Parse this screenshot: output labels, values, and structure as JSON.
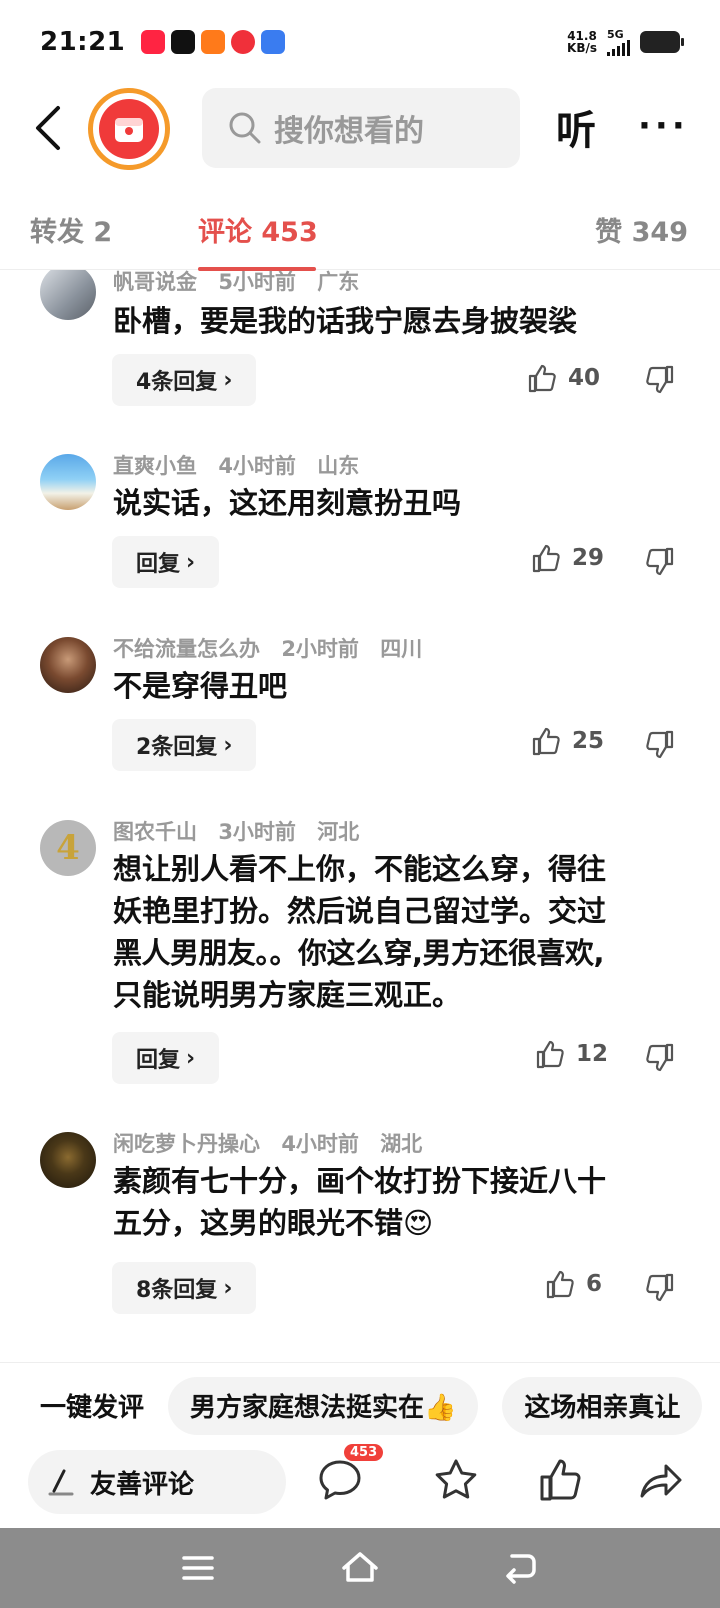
{
  "status_bar": {
    "time": "21:21",
    "net_speed_value": "41.8",
    "net_speed_unit": "KB/s",
    "signal": "5G",
    "app_icons": [
      "xiaohongshu-icon",
      "douyin-icon",
      "taobao-icon",
      "netease-music-icon",
      "baidu-icon"
    ]
  },
  "header": {
    "search_placeholder": "搜你想看的",
    "listen_label": "听",
    "more_label": "···"
  },
  "tabs": {
    "forward": "转发 2",
    "comments": "评论 453",
    "likes": "赞 349",
    "active_color": "#e4504c"
  },
  "comments": [
    {
      "user": "帆哥说金",
      "time": "5小时前",
      "location": "广东",
      "text": [
        "卧槽，要是我的话我宁愿去身披袈裟"
      ],
      "reply_label": "4条回复",
      "likes": "40"
    },
    {
      "user": "直爽小鱼",
      "time": "4小时前",
      "location": "山东",
      "text": [
        "说实话，这还用刻意扮丑吗"
      ],
      "reply_label": "回复",
      "likes": "29"
    },
    {
      "user": "不给流量怎么办",
      "time": "2小时前",
      "location": "四川",
      "text": [
        "不是穿得丑吧"
      ],
      "reply_label": "2条回复",
      "likes": "25"
    },
    {
      "user": "图农千山",
      "time": "3小时前",
      "location": "河北",
      "text": [
        "想让别人看不上你，不能这么穿，得往",
        "妖艳里打扮。然后说自己留过学。交过",
        "黑人男朋友。。你这么穿,男方还很喜欢,",
        "只能说明男方家庭三观正。"
      ],
      "reply_label": "回复",
      "likes": "12"
    },
    {
      "user": "闲吃萝卜丹操心",
      "time": "4小时前",
      "location": "湖北",
      "text": [
        "素颜有七十分，画个妆打扮下接近八十",
        "五分，这男的眼光不错😍"
      ],
      "reply_label": "8条回复",
      "likes": "6"
    }
  ],
  "quick_reply": {
    "label": "一键发评",
    "chips": [
      "男方家庭想法挺实在👍",
      "这场相亲真让"
    ]
  },
  "action_bar": {
    "input_label": "友善评论",
    "comment_badge": "453"
  }
}
